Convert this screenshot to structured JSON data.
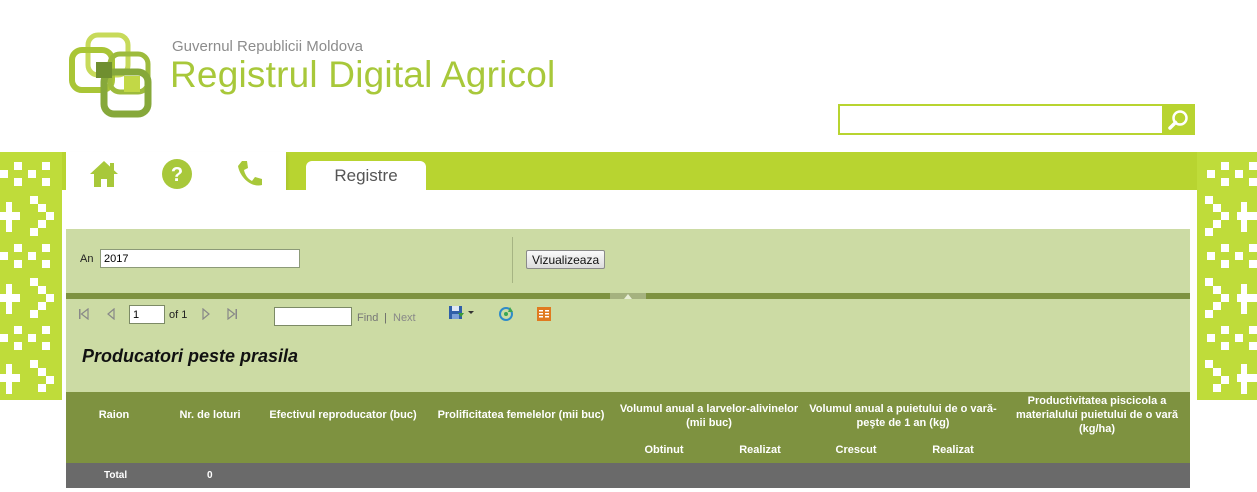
{
  "header": {
    "gov_name": "Guvernul Republicii Moldova",
    "app_title": "Registrul Digital Agricol"
  },
  "search": {
    "value": "",
    "placeholder": ""
  },
  "nav": {
    "icons": [
      "home-icon",
      "help-icon",
      "phone-icon"
    ],
    "tab_label": "Registre"
  },
  "params": {
    "year_label": "An",
    "year_value": "2017",
    "view_button": "Vizualizeaza"
  },
  "toolbar": {
    "page_value": "1",
    "of_label": "of 1",
    "find_value": "",
    "find_label": "Find",
    "find_separator": "|",
    "next_label": "Next"
  },
  "report": {
    "title": "Producatori peste prasila",
    "columns": {
      "raion": "Raion",
      "nr_loturi": "Nr. de loturi",
      "efectiv": "Efectivul  reproducator (buc)",
      "prolificitate": "Prolificitatea femelelor (mii buc)",
      "volum_larve": "Volumul anual a larvelor-alivinelor (mii buc)",
      "obtinut": "Obtinut",
      "realizat1": "Realizat",
      "volum_puiet": "Volumul anual a puietului de o vară-peşte de 1 an (kg)",
      "crescut": "Crescut",
      "realizat2": "Realizat",
      "productivitate": "Productivitatea piscicola a materialului puietului de o vară (kg/ha)"
    },
    "total_label": "Total",
    "total_nr_loturi": "0"
  },
  "colors": {
    "brand_green": "#b8d430",
    "title_green": "#a8c83a",
    "panel_green": "#ccdba4",
    "header_green": "#7e9240"
  }
}
